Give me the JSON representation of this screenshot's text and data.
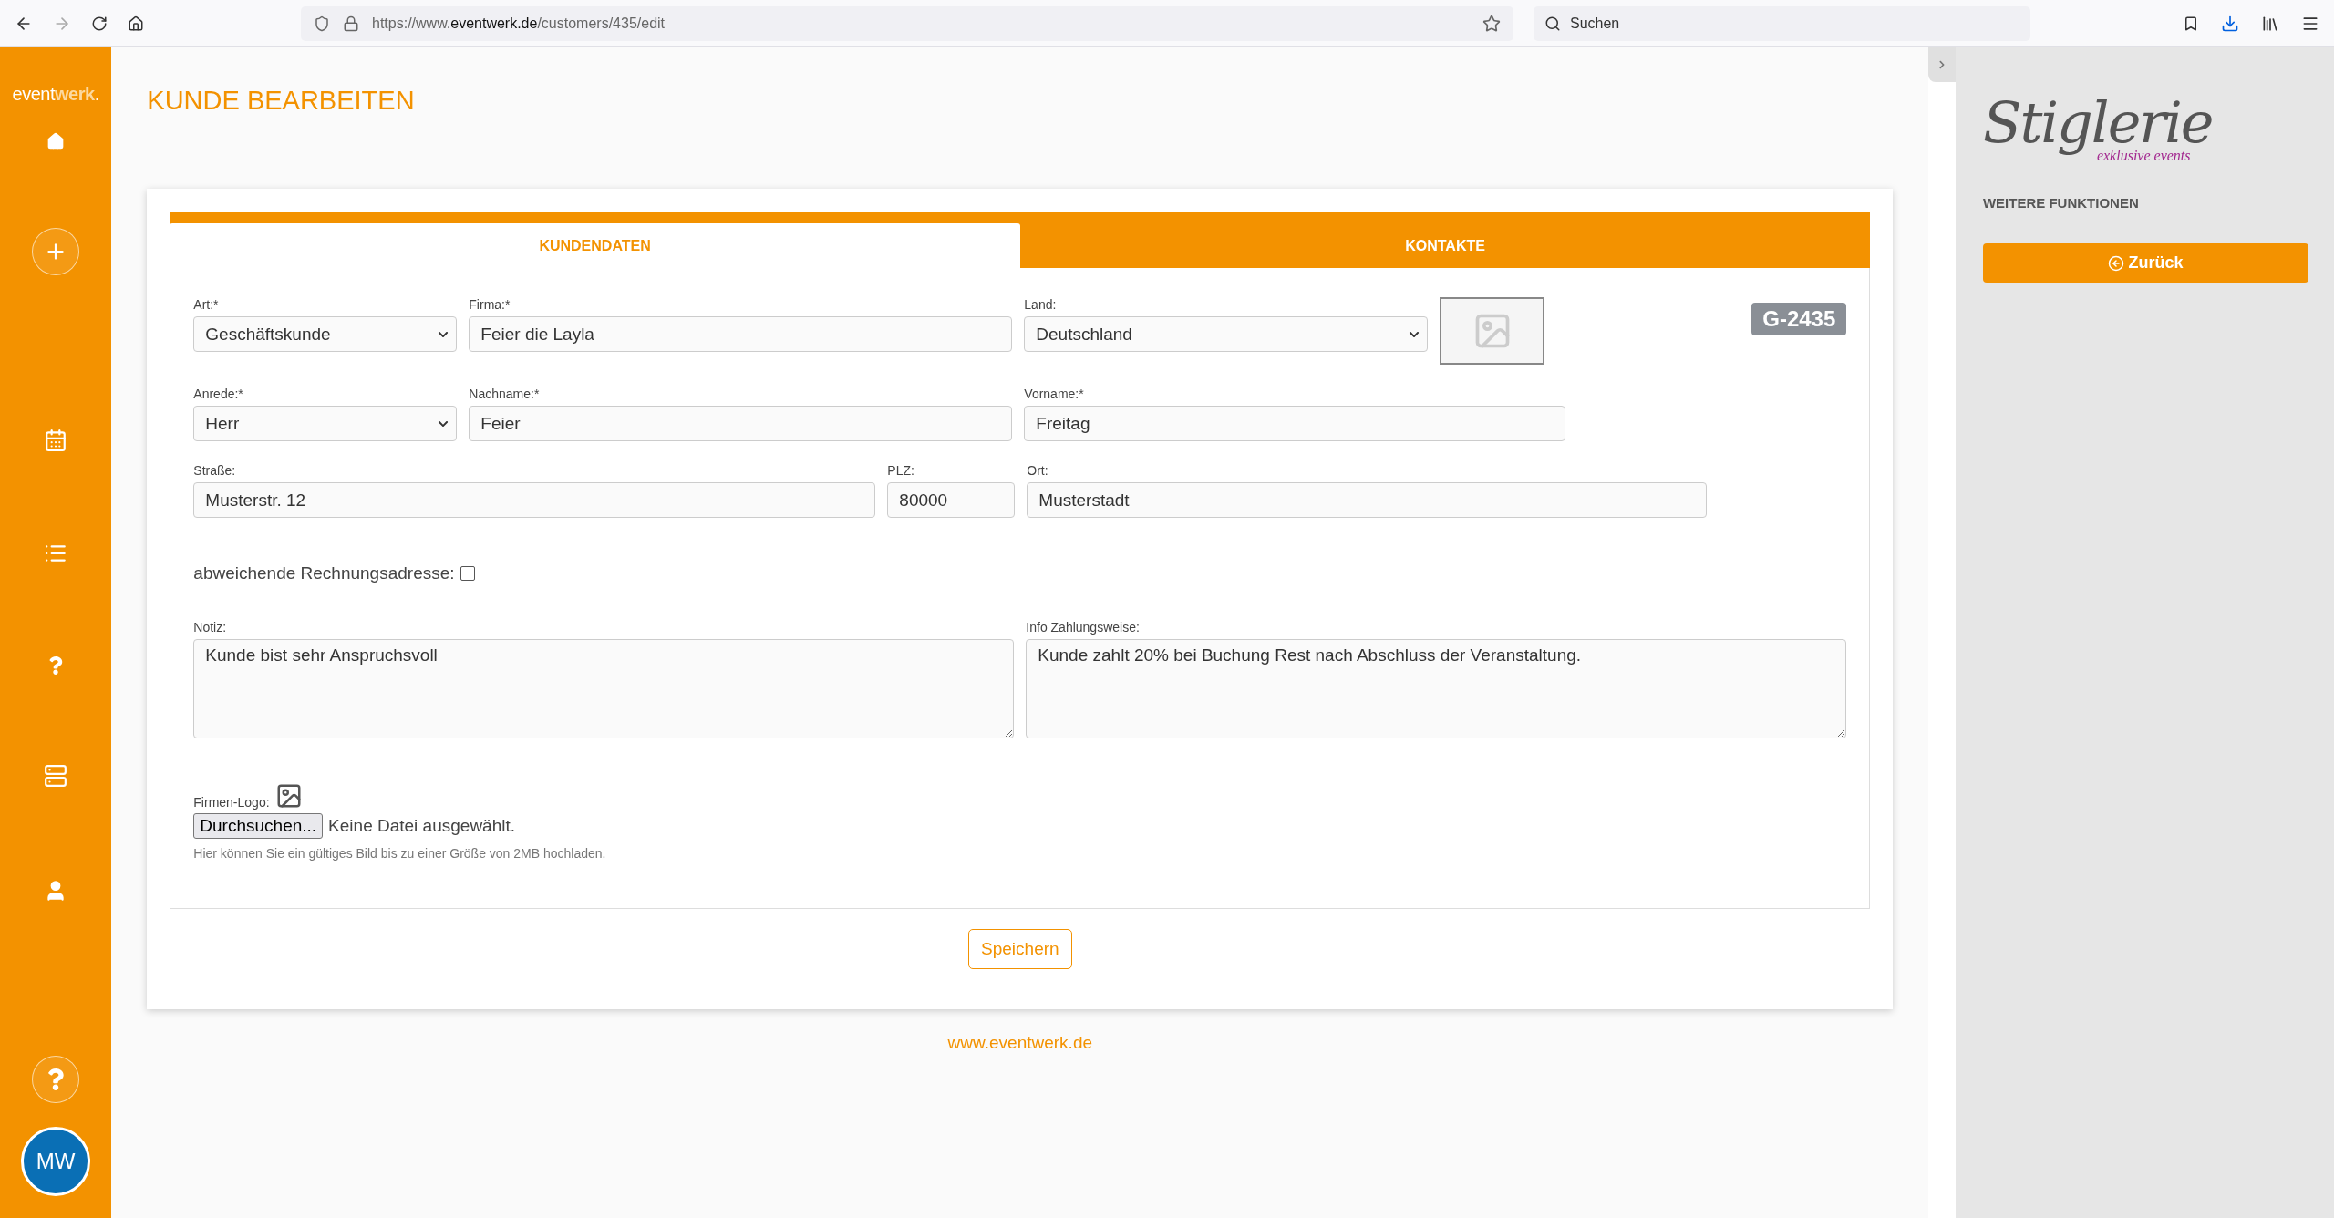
{
  "browser": {
    "url_prefix": "https://www.",
    "url_domain": "eventwerk.de",
    "url_path": "/customers/435/edit",
    "search_placeholder": "Suchen"
  },
  "sidebar": {
    "logo": [
      "event",
      "werk",
      "."
    ],
    "avatar_initials": "MW"
  },
  "page_title": "KUNDE BEARBEITEN",
  "tabs": [
    {
      "label": "KUNDENDATEN",
      "selected": true
    },
    {
      "label": "KONTAKTE",
      "selected": false
    }
  ],
  "form": {
    "rows": [
      [
        {
          "kind": "select",
          "label": "Art:*",
          "value": "Geschäftskunde"
        },
        {
          "kind": "text",
          "label": "Firma:*",
          "value": "Feier die Layla"
        },
        {
          "kind": "select",
          "label": "Land:",
          "value": "Deutschland"
        }
      ],
      [
        {
          "kind": "select",
          "label": "Anrede:*",
          "value": "Herr"
        },
        {
          "kind": "text",
          "label": "Nachname:*",
          "value": "Feier"
        },
        {
          "kind": "text",
          "label": "Vorname:*",
          "value": "Freitag"
        }
      ],
      [
        {
          "kind": "text",
          "label": "Straße:",
          "value": "Musterstr. 12"
        },
        {
          "kind": "text",
          "label": "PLZ:",
          "value": "80000"
        },
        {
          "kind": "text",
          "label": "Ort:",
          "value": "Musterstadt"
        }
      ]
    ],
    "customer_number": "G-2435",
    "billing_address": {
      "label": "abweichende Rechnungsadresse:",
      "checked": false
    },
    "notes": [
      {
        "label": "Notiz:",
        "value": "Kunde bist sehr Anspruchsvoll"
      },
      {
        "label": "Info Zahlungsweise:",
        "value": "Kunde zahlt 20% bei Buchung Rest nach Abschluss der Veranstaltung."
      }
    ],
    "logo_upload": {
      "label": "Firmen-Logo:",
      "button": "Durchsuchen...",
      "status": "Keine Datei ausgewählt.",
      "hint": "Hier können Sie ein gültiges Bild bis zu einer Größe von 2MB hochladen."
    }
  },
  "save_button": "Speichern",
  "footer_link": "www.eventwerk.de",
  "right_panel": {
    "brand": "Stiglerie",
    "tagline": "exklusive events",
    "heading": "WEITERE FUNKTIONEN",
    "back_button": "Zurück"
  }
}
